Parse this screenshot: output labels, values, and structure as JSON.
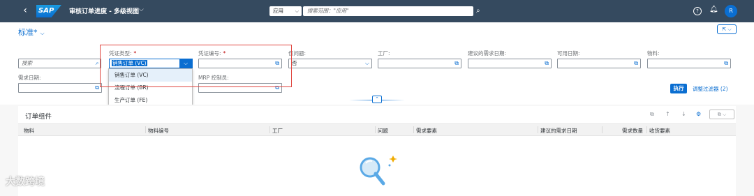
{
  "shell": {
    "back_icon": "chevron-left-icon",
    "logo": "SAP",
    "title": "审核订单进度 - 多级视图",
    "scope_label": "应用",
    "search_placeholder": "搜索范围：\"应用\"",
    "avatar_initial": "R"
  },
  "variant": {
    "name": "标准*"
  },
  "filters": {
    "search_placeholder": "搜索",
    "doc_type_label": "凭证类型:",
    "doc_type_value": "销售订单 (VC)",
    "doc_number_label": "凭证编号:",
    "issue_only_label": "仅问题:",
    "issue_only_value": "否",
    "plant_label": "工厂:",
    "suggested_date_label": "建议的需求日期:",
    "available_date_label": "可用日期:",
    "material_label": "物料:",
    "req_date_label": "需求日期:",
    "mrp_label": "MRP 控制员:",
    "required_marker": "*",
    "go_label": "执行",
    "adapt_label": "调整过滤器 (2)"
  },
  "doc_type_options": [
    "销售订单 (VC)",
    "流程订单 (BR)",
    "生产订单 (FE)"
  ],
  "table": {
    "title": "订单组件",
    "columns": [
      "物料",
      "物料编号",
      "工厂",
      "问题",
      "需求要素",
      "建议的需求日期",
      "需求数量",
      "收货要素"
    ]
  },
  "watermark": "大数跨境",
  "colors": {
    "shell_bg": "#354a5f",
    "accent": "#0a6ed1",
    "highlight_box": "#e0463f"
  }
}
